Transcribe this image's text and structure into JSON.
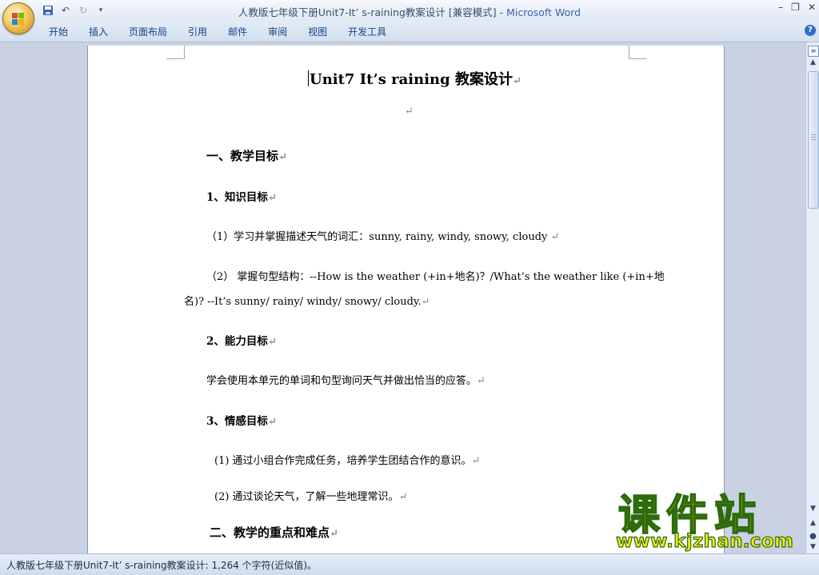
{
  "window": {
    "title_doc": "人教版七年级下册Unit7-It’ s-raining教案设计 [兼容模式]",
    "title_sep": " - ",
    "title_app": "Microsoft Word",
    "controls": {
      "minimize": "–",
      "restore": "❐",
      "close": "✕"
    }
  },
  "qat": {
    "save_icon": "save-icon",
    "undo_icon": "undo-icon",
    "redo_icon": "redo-icon",
    "customize_icon": "customize-icon"
  },
  "ribbon": {
    "tabs": [
      "开始",
      "插入",
      "页面布局",
      "引用",
      "邮件",
      "审阅",
      "视图",
      "开发工具"
    ],
    "help": "?"
  },
  "document": {
    "title": "Unit7 It’s raining 教案设计",
    "blank_mark": "↵",
    "section1": "一、教学目标",
    "sub1": "1、知识目标",
    "k1": "（1）学习并掌握描述天气的词汇：sunny, rainy, windy, snowy, cloudy ",
    "k2a": "（2） 掌握句型结构：--How is the weather (+in+地名)？/What’s the weather like (+in+地",
    "k2b": "名)? --It’s sunny/ rainy/ windy/ snowy/ cloudy.",
    "sub2": "2、能力目标",
    "ability": "学会使用本单元的单词和句型询问天气并做出恰当的应答。",
    "sub3": "3、情感目标",
    "e1": "(1) 通过小组合作完成任务，培养学生团结合作的意识。",
    "e2": "(2) 通过谈论天气，了解一些地理常识。",
    "section2": "二、教学的重点和难点"
  },
  "status": {
    "text": "人教版七年级下册Unit7-It’ s-raining教案设计: 1,264 个字符(近似值)。"
  },
  "watermark": {
    "logo_text": "课件站",
    "url": "www.kjzhan.com"
  }
}
